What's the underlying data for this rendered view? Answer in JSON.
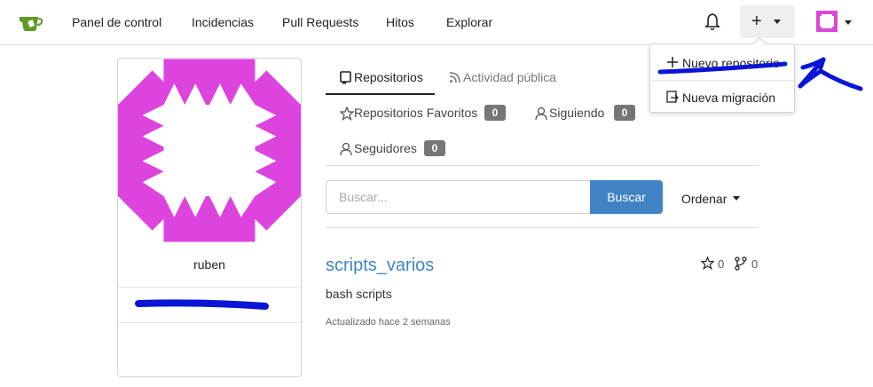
{
  "nav": {
    "items": [
      "Panel de control",
      "Incidencias",
      "Pull Requests",
      "Hitos",
      "Explorar"
    ],
    "plus_symbol": "+"
  },
  "icons": {
    "logo": "gitea-teacup-icon",
    "notifications": "bell-icon",
    "create": "plus-icon",
    "avatar": "identicon-avatar"
  },
  "dropdown": {
    "items": [
      {
        "label": "Nuevo repositorio",
        "icon": "plus-icon"
      },
      {
        "label": "Nueva migración",
        "icon": "migration-icon"
      }
    ]
  },
  "profile": {
    "username": "ruben",
    "identicon_color": "#dd44dd"
  },
  "tabs": {
    "repositories": "Repositorios",
    "activity": "Actividad pública",
    "starred": "Repositorios Favoritos",
    "starred_count": "0",
    "following": "Siguiendo",
    "following_count": "0",
    "followers": "Seguidores",
    "followers_count": "0"
  },
  "search": {
    "placeholder": "Buscar...",
    "button": "Buscar",
    "sort": "Ordenar"
  },
  "repos": [
    {
      "name": "scripts_varios",
      "description": "bash scripts",
      "updated": "Actualizado hace 2 semanas",
      "stars": "0",
      "forks": "0"
    }
  ],
  "colors": {
    "accent": "#4183c4",
    "annotation": "#0a14d6"
  }
}
